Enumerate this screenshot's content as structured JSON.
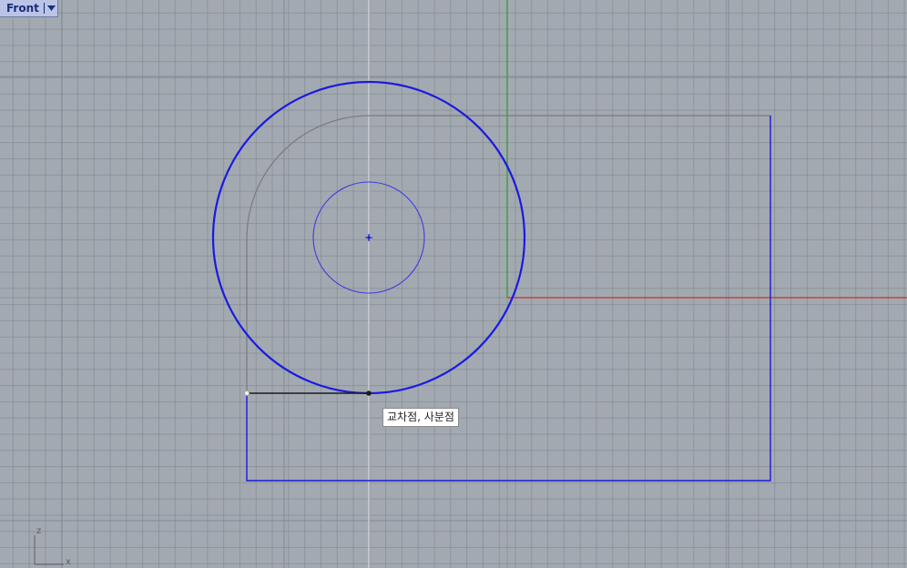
{
  "viewport": {
    "name": "Front",
    "background_color": "#a3a9b1",
    "grid_color": "#7d838c",
    "x_axis_color": "#c0392b",
    "y_axis_color": "#2e9e3a",
    "curve_color": "#1a1ae0",
    "construction_color": "#7a7a80"
  },
  "tooltip": {
    "text": "교차점, 사분점"
  },
  "axis_widget": {
    "vertical_label": "z",
    "horizontal_label": "x"
  },
  "icons": {
    "dropdown": "triangle-down-icon",
    "center_marker": "crosshair-icon"
  }
}
